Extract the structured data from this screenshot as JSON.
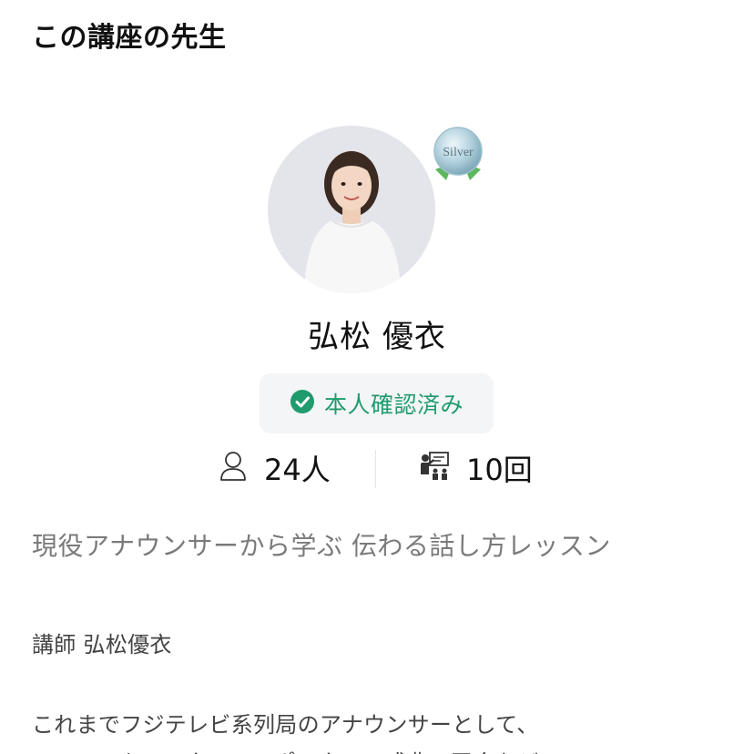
{
  "section": {
    "title": "この講座の先生"
  },
  "teacher": {
    "name": "弘松 優衣",
    "rank_badge": "Silver",
    "verified_label": "本人確認済み",
    "verified_color": "#1f9b6e",
    "stats": {
      "students": "24人",
      "sessions": "10回"
    },
    "icons": {
      "students": "person-outline-icon",
      "sessions": "teacher-at-board-icon",
      "verified": "check-circle-icon"
    }
  },
  "course": {
    "title": "現役アナウンサーから学ぶ 伝わる話し方レッスン"
  },
  "description": {
    "lines": [
      "講師 弘松優衣",
      "これまでフジテレビ系列局のアナウンサーとして、",
      "ニュースキャスター、リポーター、式典の司会など、"
    ]
  }
}
